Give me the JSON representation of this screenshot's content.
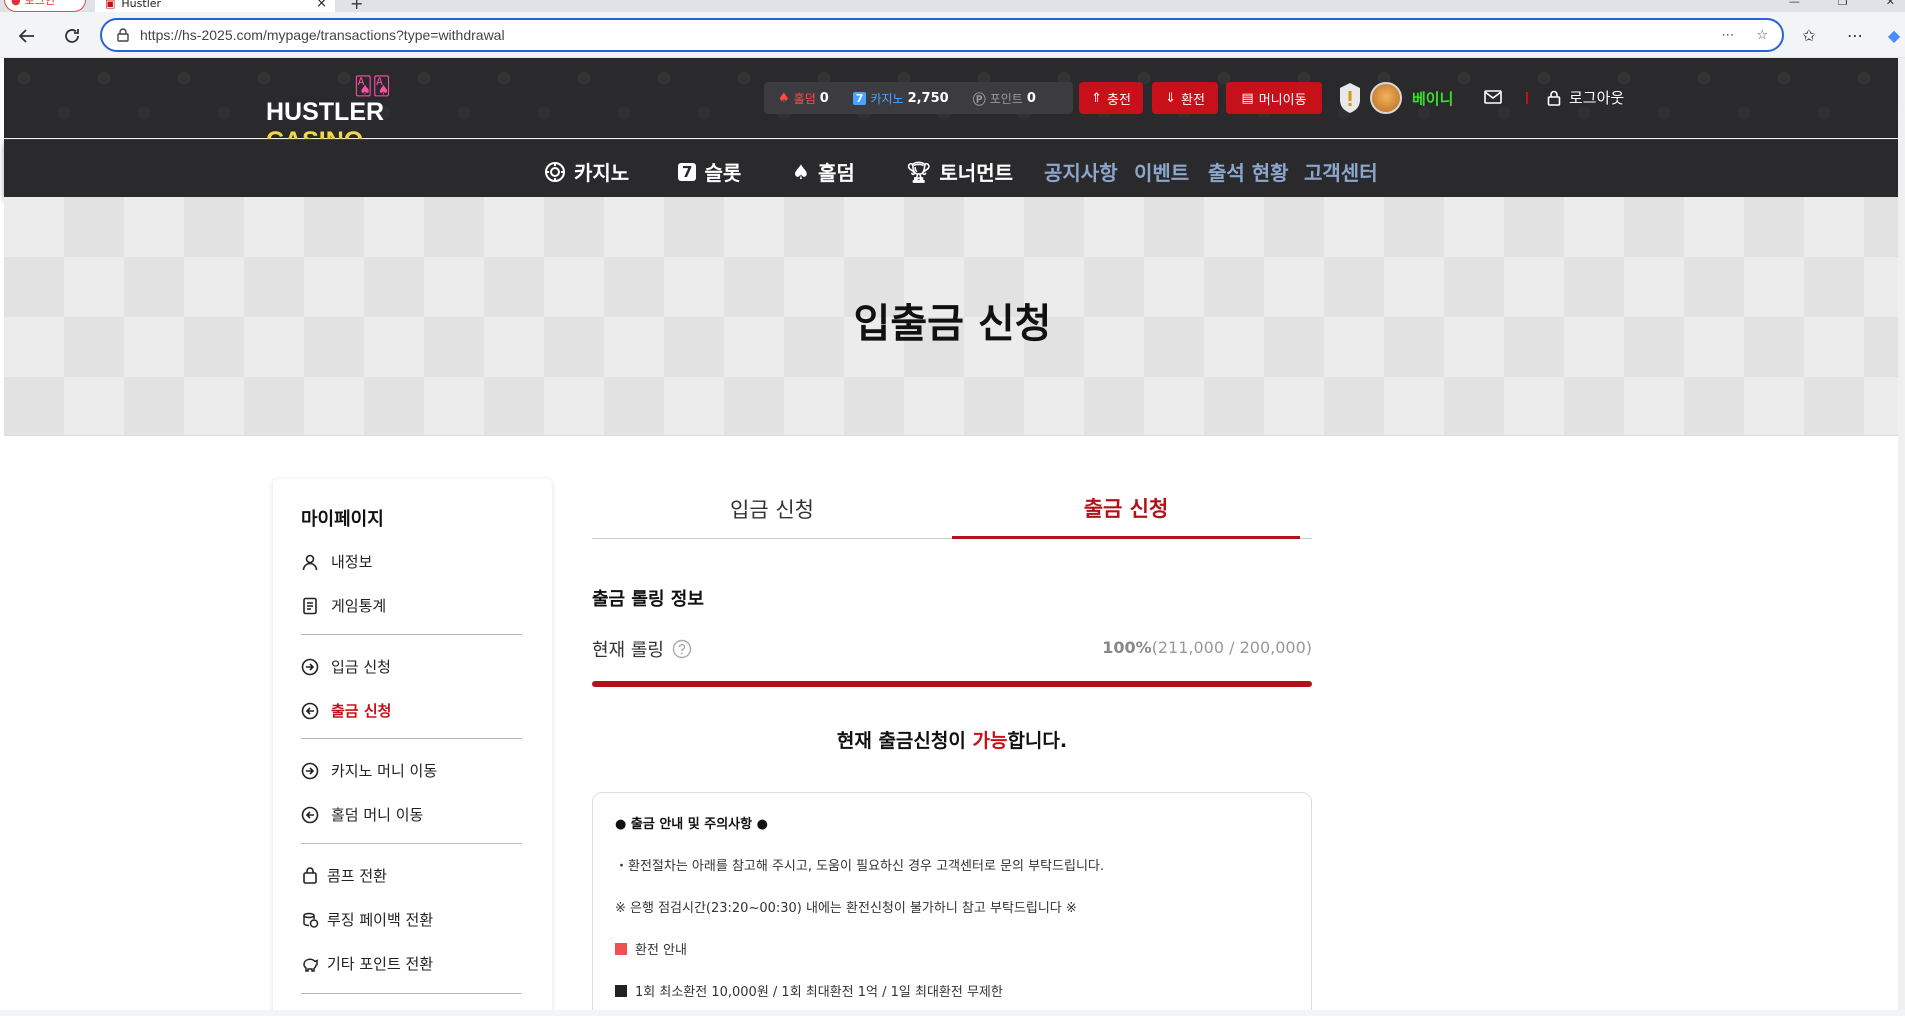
{
  "browser": {
    "tabs": [
      {
        "label": "로그인"
      },
      {
        "label": "Hustler"
      }
    ],
    "url": "https://hs-2025.com/mypage/transactions?type=withdrawal"
  },
  "header": {
    "logo_part1": "HUSTLER",
    "logo_part2": "CASINO",
    "balances": [
      {
        "label": "홀덤",
        "value": "0",
        "color": "#ff4a4a",
        "icon": "spade-icon"
      },
      {
        "label": "카지노",
        "value": "2,750",
        "color": "#4aa3ff",
        "icon": "slot-7-icon"
      },
      {
        "label": "포인트",
        "value": "0",
        "color": "#9a9a9a",
        "icon": "point-coin-icon"
      }
    ],
    "buttons": [
      {
        "label": "충전",
        "icon": "charge-icon"
      },
      {
        "label": "환전",
        "icon": "exchange-icon"
      },
      {
        "label": "머니이동",
        "icon": "money-transfer-icon"
      }
    ],
    "nickname": "베이니",
    "logout_label": "로그아웃",
    "accent_color": "#c8101a",
    "nickname_color": "#3adf2c"
  },
  "nav": {
    "main_items": [
      {
        "label": "카지노",
        "icon": "casino-chip-icon"
      },
      {
        "label": "슬롯",
        "icon": "slot-7-icon"
      },
      {
        "label": "홀덤",
        "icon": "spade-icon"
      },
      {
        "label": "토너먼트",
        "icon": "trophy-icon"
      }
    ],
    "sub_items": [
      {
        "label": "공지사항"
      },
      {
        "label": "이벤트"
      },
      {
        "label": "출석 현황"
      },
      {
        "label": "고객센터"
      }
    ]
  },
  "banner": {
    "title": "입출금 신청"
  },
  "sidebar": {
    "title": "마이페이지",
    "groups": [
      [
        {
          "label": "내정보",
          "icon": "user-icon"
        },
        {
          "label": "게임통계",
          "icon": "document-icon"
        }
      ],
      [
        {
          "label": "입금 신청",
          "icon": "arrow-right-circle-icon"
        },
        {
          "label": "출금 신청",
          "icon": "arrow-left-circle-icon",
          "active": true
        }
      ],
      [
        {
          "label": "카지노 머니 이동",
          "icon": "arrow-right-circle-icon"
        },
        {
          "label": "홀덤 머니 이동",
          "icon": "arrow-left-circle-icon"
        }
      ],
      [
        {
          "label": "콤프 전환",
          "icon": "bag-icon"
        },
        {
          "label": "루징 페이백 전환",
          "icon": "coins-icon"
        },
        {
          "label": "기타 포인트 전환",
          "icon": "piggy-bank-icon"
        }
      ]
    ]
  },
  "main": {
    "tabs": [
      {
        "label": "입금 신청",
        "active": false
      },
      {
        "label": "출금 신청",
        "active": true
      }
    ],
    "rolling": {
      "section_title": "출금 롤링 정보",
      "label": "현재 롤링",
      "percent": "100%",
      "detail": "(211,000 / 200,000)",
      "progress_fraction": 1.0
    },
    "status": {
      "before": "현재 출금신청이 ",
      "highlight": "가능",
      "after": "합니다."
    },
    "notice": {
      "title": "● 출금 안내 및 주의사항 ●",
      "lines": [
        {
          "text": "・환전절차는 아래를 참고해 주시고, 도움이 필요하신 경우 고객센터로 문의 부탁드립니다."
        },
        {
          "text": "※ 은행 점검시간(23:20~00:30) 내에는 환전신청이 불가하니 참고 부탁드립니다 ※"
        },
        {
          "text": "환전 안내",
          "square_color": "#f05050"
        },
        {
          "text": "1회 최소환전 10,000원 / 1회 최대환전 1억 / 1일 최대환전 무제한",
          "square_color": "#222222"
        }
      ]
    }
  }
}
